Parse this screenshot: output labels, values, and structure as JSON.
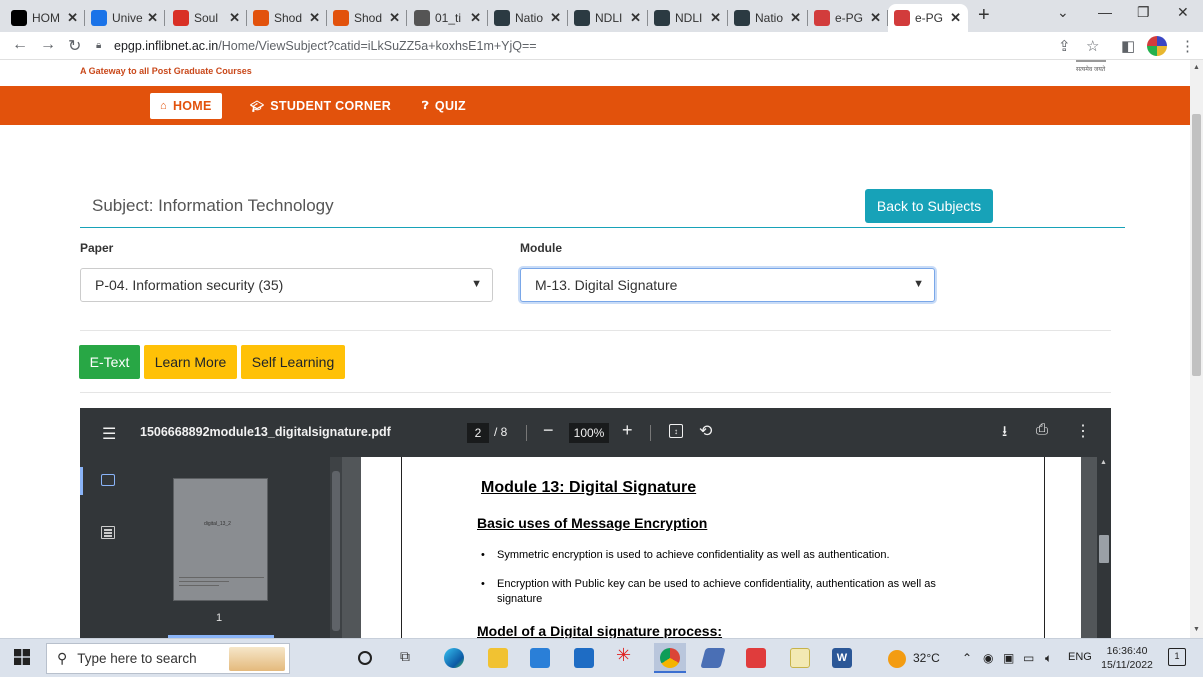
{
  "browser": {
    "tabs": [
      {
        "title": "HOM",
        "favicon": "wix-icon",
        "color": "#000000"
      },
      {
        "title": "Unive",
        "favicon": "drive-icon",
        "color": "#1a73e8"
      },
      {
        "title": "Soul",
        "favicon": "gmail-icon",
        "color": "#d93025"
      },
      {
        "title": "Shod",
        "favicon": "shodhganga-icon",
        "color": "#e2520c"
      },
      {
        "title": "Shod",
        "favicon": "shodhganga-icon",
        "color": "#e2520c"
      },
      {
        "title": "01_ti",
        "favicon": "pdf-icon",
        "color": "#555555"
      },
      {
        "title": "Natio",
        "favicon": "ndl-icon",
        "color": "#2b3a42"
      },
      {
        "title": "NDLI",
        "favicon": "ndl-icon",
        "color": "#2b3a42"
      },
      {
        "title": "NDLI",
        "favicon": "ndl-icon",
        "color": "#2b3a42"
      },
      {
        "title": "Natio",
        "favicon": "ndl-icon",
        "color": "#2b3a42"
      },
      {
        "title": "e-PG",
        "favicon": "epg-icon",
        "color": "#d23c3c"
      },
      {
        "title": "e-PG",
        "favicon": "epg-icon",
        "color": "#d23c3c",
        "active": true
      }
    ],
    "new_tab": "+",
    "url_domain": "epgp.inflibnet.ac.in",
    "url_path": "/Home/ViewSubject?catid=iLkSuZZ5a+koxhsE1m+YjQ=="
  },
  "site": {
    "tagline": "A Gateway to all Post Graduate Courses",
    "emblem_text": "सत्यमेव जयते",
    "nav": {
      "home": "HOME",
      "student_corner": "STUDENT CORNER",
      "quiz": "QUIZ"
    }
  },
  "subject": {
    "title": "Subject: Information Technology",
    "back_label": "Back to Subjects",
    "paper_label": "Paper",
    "paper_value": "P-04. Information security (35)",
    "module_label": "Module",
    "module_value": "M-13. Digital Signature"
  },
  "buttons": {
    "etext": "E-Text",
    "learn_more": "Learn More",
    "self_learning": "Self Learning"
  },
  "pdf": {
    "filename": "1506668892module13_digitalsignature.pdf",
    "page_current": "2",
    "page_total": "/ 8",
    "zoom": "100%",
    "thumb_label": "digital_13_2",
    "thumb_page": "1",
    "heading": "Module 13: Digital Signature",
    "subheading": "Basic uses of Message Encryption",
    "bullets": [
      "Symmetric encryption  is used to achieve confidentiality as well as authentication.",
      "Encryption with Public key  can be used to achieve confidentiality, authentication as well as  signature"
    ],
    "next_heading": "Model of a Digital signature process:"
  },
  "taskbar": {
    "search_placeholder": "Type here to search",
    "weather": "32°C",
    "language": "ENG",
    "time": "16:36:40",
    "date": "15/11/2022"
  }
}
